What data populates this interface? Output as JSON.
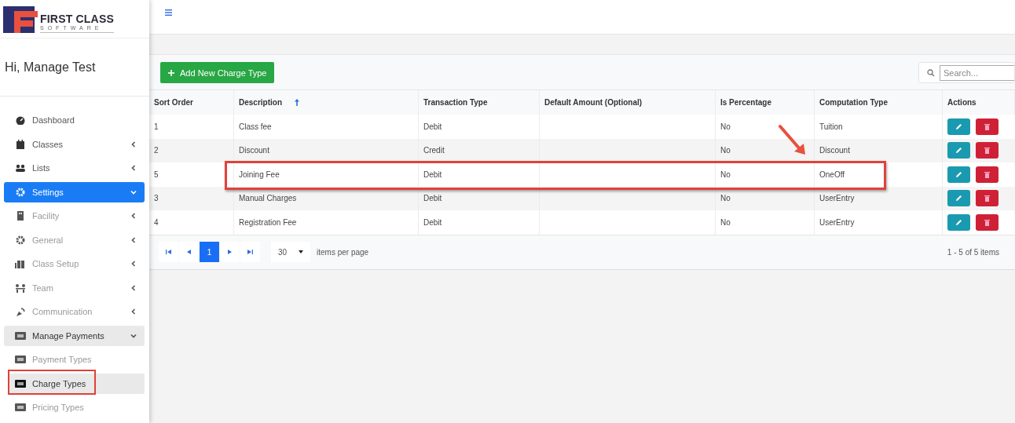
{
  "logo": {
    "title": "FIRST CLASS",
    "subtitle": "SOFTWARE"
  },
  "greeting": "Hi, Manage Test",
  "sidebar": {
    "items": [
      {
        "label": "Dashboard",
        "selected": false
      },
      {
        "label": "Classes",
        "selected": false,
        "expanded": false
      },
      {
        "label": "Lists",
        "selected": false,
        "expanded": false
      },
      {
        "label": "Settings",
        "selected": true,
        "expanded": true,
        "children": [
          {
            "label": "Facility",
            "selected": false,
            "expanded": false
          },
          {
            "label": "General",
            "selected": false,
            "expanded": false
          },
          {
            "label": "Class Setup",
            "selected": false,
            "expanded": false
          },
          {
            "label": "Team",
            "selected": false,
            "expanded": false
          },
          {
            "label": "Communication",
            "selected": false,
            "expanded": false
          },
          {
            "label": "Manage Payments",
            "selected": true,
            "expanded": true,
            "children": [
              {
                "label": "Payment Types",
                "selected": false
              },
              {
                "label": "Charge Types",
                "selected": true,
                "annotated": true
              },
              {
                "label": "Pricing Types",
                "selected": false
              }
            ]
          }
        ]
      }
    ]
  },
  "toolbar": {
    "add_button": "Add New Charge Type",
    "search": {
      "placeholder": "Search..."
    }
  },
  "table": {
    "columns": [
      {
        "label": "Sort Order",
        "sorted": false
      },
      {
        "label": "Description",
        "sorted": true
      },
      {
        "label": "Transaction Type",
        "sorted": false
      },
      {
        "label": "Default Amount (Optional)",
        "sorted": false
      },
      {
        "label": "Is Percentage",
        "sorted": false
      },
      {
        "label": "Computation Type",
        "sorted": false
      },
      {
        "label": "Actions",
        "sorted": false
      }
    ],
    "rows": [
      {
        "cells": [
          "1",
          "Class fee",
          "Debit",
          "",
          "No",
          "Tuition"
        ],
        "annotated": false
      },
      {
        "cells": [
          "2",
          "Discount",
          "Credit",
          "",
          "No",
          "Discount"
        ],
        "annotated": false
      },
      {
        "cells": [
          "5",
          "Joining Fee",
          "Debit",
          "",
          "No",
          "OneOff"
        ],
        "annotated": true
      },
      {
        "cells": [
          "3",
          "Manual Charges",
          "Debit",
          "",
          "No",
          "UserEntry"
        ],
        "annotated": false
      },
      {
        "cells": [
          "4",
          "Registration Fee",
          "Debit",
          "",
          "No",
          "UserEntry"
        ],
        "annotated": false
      }
    ]
  },
  "pager": {
    "pages": [
      {
        "label": "1",
        "selected": true
      }
    ],
    "page_size": "30",
    "page_size_label": "items per page",
    "summary": "1 - 5 of 5 items"
  }
}
